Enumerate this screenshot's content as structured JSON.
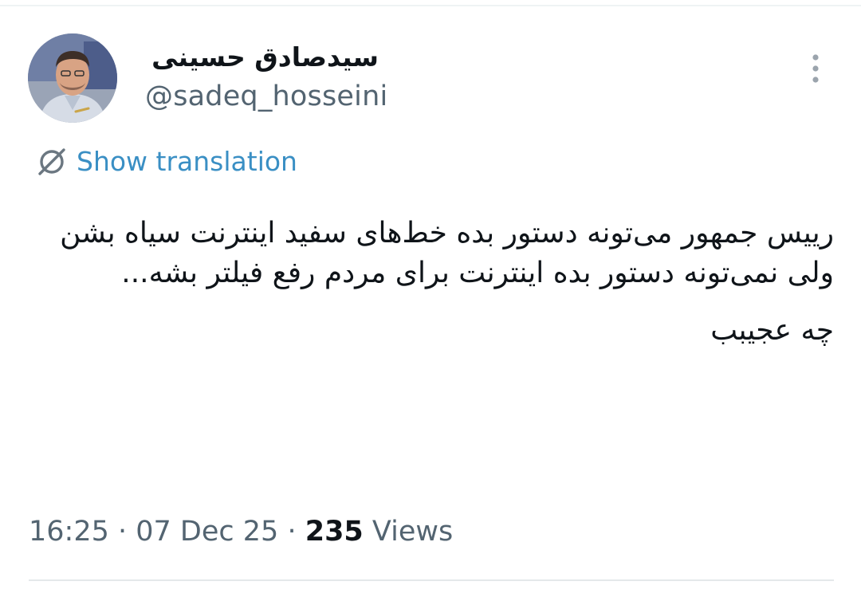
{
  "author": {
    "display_name": "سیدصادق حسینی",
    "handle": "@sadeq_hosseini"
  },
  "more_icon": "more-vertical-icon",
  "translation": {
    "icon": "translate-icon",
    "label": "Show translation"
  },
  "tweet": {
    "paragraphs": [
      "رییس جمهور می‌تونه دستور بده خط‌های سفید اینترنت سیاه بشن ولی نمی‌تونه دستور بده اینترنت برای مردم رفع فیلتر بشه...",
      "چه عجیبب"
    ]
  },
  "meta": {
    "time": "16:25",
    "separator": " · ",
    "date": "07 Dec 25",
    "views_count": "235",
    "views_label": "Views"
  },
  "colors": {
    "text": "#0f1419",
    "secondary": "#536471",
    "link": "#3a8fc4"
  }
}
